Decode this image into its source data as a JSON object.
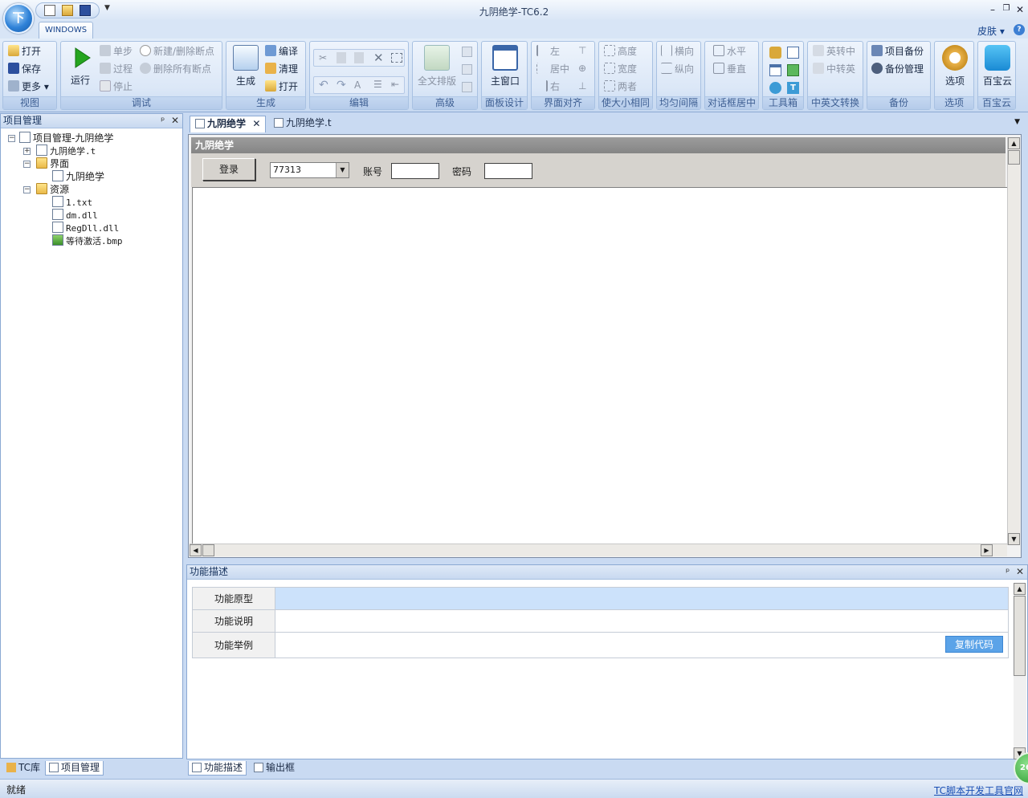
{
  "window": {
    "title": "九阴绝学-TC6.2",
    "app_orb_glyph": "下"
  },
  "ribbon": {
    "tab": "WINDOWS",
    "skin_label": "皮肤",
    "groups": {
      "view": {
        "label": "视图",
        "open": "打开",
        "save": "保存",
        "more": "更多"
      },
      "debug": {
        "label": "调试",
        "run": "运行",
        "step": "单步",
        "procedure": "过程",
        "stop": "停止",
        "toggle_breakpoint": "新建/删除断点",
        "clear_breakpoints": "删除所有断点"
      },
      "build": {
        "label": "生成",
        "generate": "生成",
        "compile": "编译",
        "clean": "清理",
        "open": "打开"
      },
      "edit": {
        "label": "编辑"
      },
      "advanced": {
        "label": "高级",
        "format_all": "全文排版"
      },
      "panel": {
        "label": "面板设计",
        "main_window": "主窗口"
      },
      "align": {
        "label": "界面对齐",
        "left": "左",
        "center": "居中",
        "right": "右"
      },
      "same_size": {
        "label": "使大小相同",
        "height": "高度",
        "width": "宽度",
        "both": "两者"
      },
      "spacing": {
        "label": "均匀间隔",
        "horizontal": "横向",
        "vertical": "纵向"
      },
      "dialog_center": {
        "label": "对话框居中",
        "horizontal": "水平",
        "vertical": "垂直"
      },
      "toolbox": {
        "label": "工具箱"
      },
      "translate": {
        "label": "中英文转换",
        "en_to_cn": "英转中",
        "cn_to_en": "中转英"
      },
      "backup": {
        "label": "备份",
        "project_backup": "项目备份",
        "backup_manage": "备份管理"
      },
      "options": {
        "label": "选项",
        "options": "选项"
      },
      "cloud": {
        "label": "百宝云",
        "cloud": "百宝云"
      }
    }
  },
  "left_pane": {
    "title": "项目管理",
    "tree": {
      "root": "项目管理-九阴绝学",
      "script_file": "九阴绝学.t",
      "ui_folder": "界面",
      "ui_item": "九阴绝学",
      "res_folder": "资源",
      "res_files": [
        "1.txt",
        "dm.dll",
        "RegDll.dll",
        "等待激活.bmp"
      ]
    },
    "bottom_tabs": [
      "TC库",
      "项目管理"
    ]
  },
  "doc_tabs": [
    "九阴绝学",
    "九阴绝学.t"
  ],
  "designer": {
    "form_title": "九阴绝学",
    "login_button": "登录",
    "combo_value": "77313",
    "account_label": "账号",
    "password_label": "密码"
  },
  "func_pane": {
    "title": "功能描述",
    "rows": [
      "功能原型",
      "功能说明",
      "功能举例"
    ],
    "copy_button": "复制代码",
    "bottom_tabs": [
      "功能描述",
      "输出框"
    ]
  },
  "status": {
    "text": "就绪",
    "link": "TC脚本开发工具官网",
    "badge": "26"
  }
}
